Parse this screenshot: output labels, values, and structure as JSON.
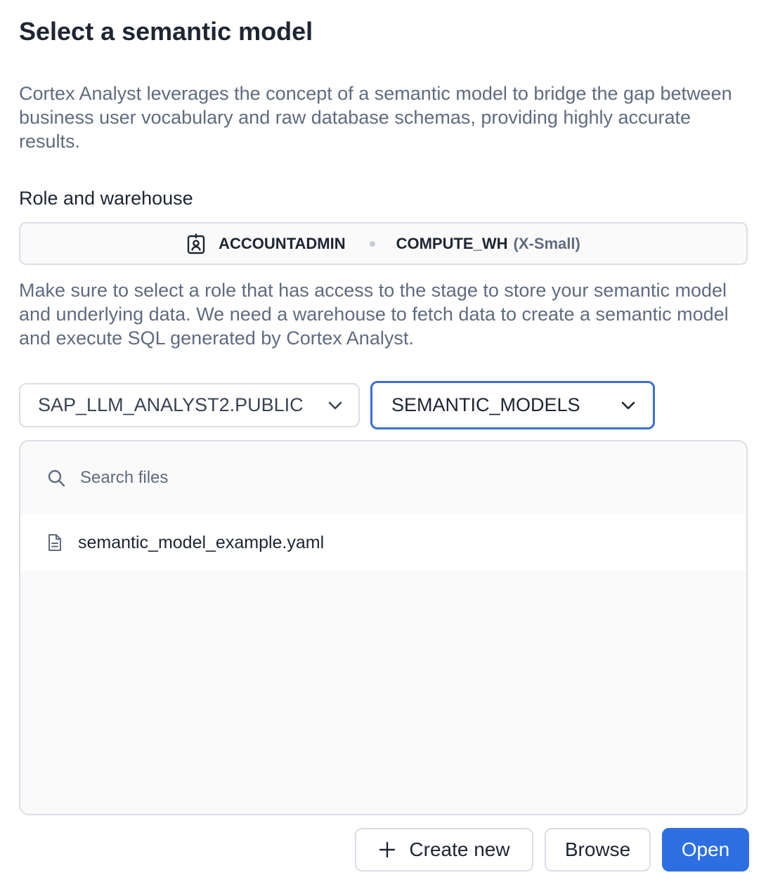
{
  "dialog": {
    "title": "Select a semantic model",
    "description": "Cortex Analyst leverages the concept of a semantic model to bridge the gap between business user vocabulary and raw database schemas, providing highly accurate results."
  },
  "role_warehouse": {
    "label": "Role and warehouse",
    "role": "ACCOUNTADMIN",
    "warehouse": "COMPUTE_WH",
    "warehouse_size": "(X-Small)",
    "hint": "Make sure to select a role that has access to the stage to store your semantic model and underlying data. We need a warehouse to fetch data to create a semantic model and execute SQL generated by Cortex Analyst.",
    "icon": "contact-badge-icon"
  },
  "selectors": {
    "schema": "SAP_LLM_ANALYST2.PUBLIC",
    "stage": "SEMANTIC_MODELS"
  },
  "files": {
    "search_placeholder": "Search files",
    "items": [
      {
        "name": "semantic_model_example.yaml",
        "icon": "file-icon"
      }
    ]
  },
  "actions": {
    "create_new": "Create new",
    "browse": "Browse",
    "open": "Open"
  },
  "colors": {
    "primary": "#2d6fe3",
    "focus_border": "#3a6fd8",
    "text": "#1e2533",
    "muted_text": "#5f6b80",
    "border": "#dbdee5"
  }
}
